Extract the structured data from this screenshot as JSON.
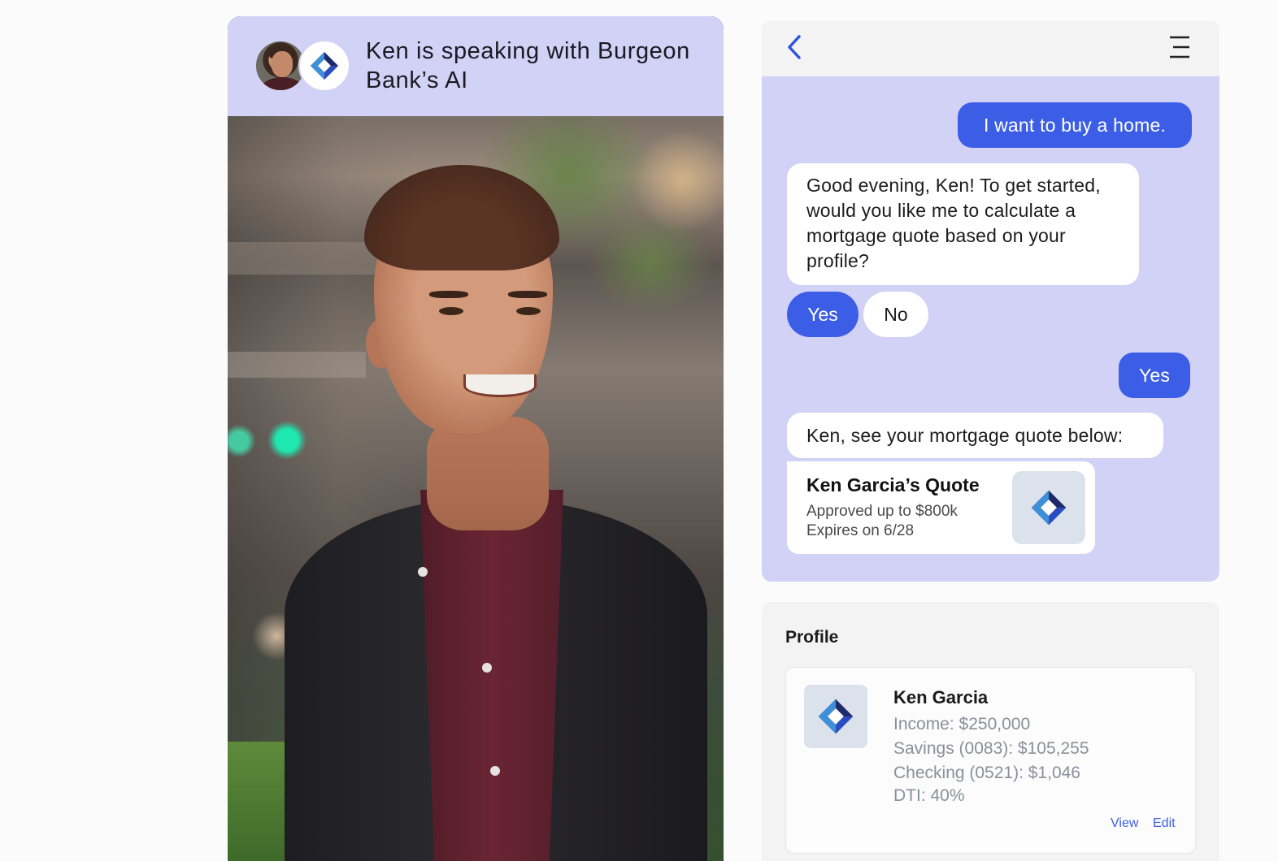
{
  "video_card": {
    "title": "Ken is speaking with Burgeon Bank’s AI"
  },
  "chat": {
    "messages": [
      {
        "from": "user",
        "text": "I want to buy a home."
      },
      {
        "from": "bot",
        "text": "Good evening, Ken! To get started, would you like me to calculate a mortgage quote based on your profile?"
      },
      {
        "from": "user",
        "text": "Yes"
      },
      {
        "from": "bot",
        "text": "Ken, see your mortgage quote below:"
      }
    ],
    "choices": {
      "yes": "Yes",
      "no": "No"
    },
    "quote": {
      "title": "Ken Garcia’s Quote",
      "line1": "Approved up to $800k",
      "line2": "Expires on 6/28"
    }
  },
  "profile": {
    "heading": "Profile",
    "name": "Ken Garcia",
    "income": "Income: $250,000",
    "savings": "Savings (0083): $105,255",
    "checking": "Checking (0521): $1,046",
    "dti": "DTI: 40%",
    "view_label": "View",
    "edit_label": "Edit"
  },
  "colors": {
    "accent_blue": "#3c5ee6",
    "lavender": "#d2d1f6",
    "panel_gray": "#f3f3f4"
  },
  "icons": [
    "back-chevron-icon",
    "hamburger-menu-icon",
    "burgeon-bank-logo-icon"
  ]
}
